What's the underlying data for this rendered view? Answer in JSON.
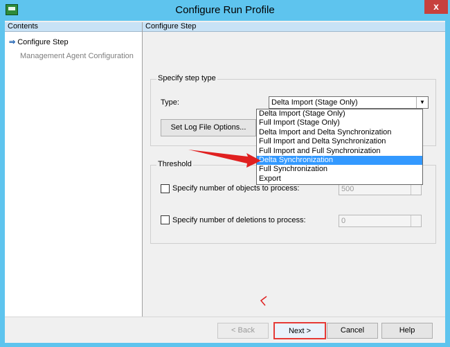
{
  "window": {
    "title": "Configure Run Profile",
    "close": "x"
  },
  "left_pane": {
    "header": "Contents",
    "items": [
      {
        "label": "Configure Step",
        "state": "active"
      },
      {
        "label": "Management Agent Configuration",
        "state": "disabled"
      }
    ]
  },
  "right_pane": {
    "header": "Configure Step"
  },
  "step_type": {
    "legend": "Specify step type",
    "type_label": "Type:",
    "selected_value": "Delta Import (Stage Only)",
    "log_button": "Set Log File Options...",
    "options": [
      "Delta Import (Stage Only)",
      "Full Import (Stage Only)",
      "Delta Import and Delta Synchronization",
      "Full Import and Delta Synchronization",
      "Full Import and Full Synchronization",
      "Delta Synchronization",
      "Full Synchronization",
      "Export"
    ],
    "highlighted_option": "Delta Synchronization"
  },
  "threshold": {
    "legend": "Threshold",
    "objects_label": "Specify number of objects to process:",
    "objects_value": "500",
    "deletions_label": "Specify number of deletions to process:",
    "deletions_value": "0"
  },
  "buttons": {
    "back": "< Back",
    "next": "Next >",
    "cancel": "Cancel",
    "help": "Help"
  },
  "colors": {
    "title_bar": "#5ec4ee",
    "pane_header": "#c8e2f6",
    "selection": "#3399ff",
    "annotation": "#e02020"
  }
}
